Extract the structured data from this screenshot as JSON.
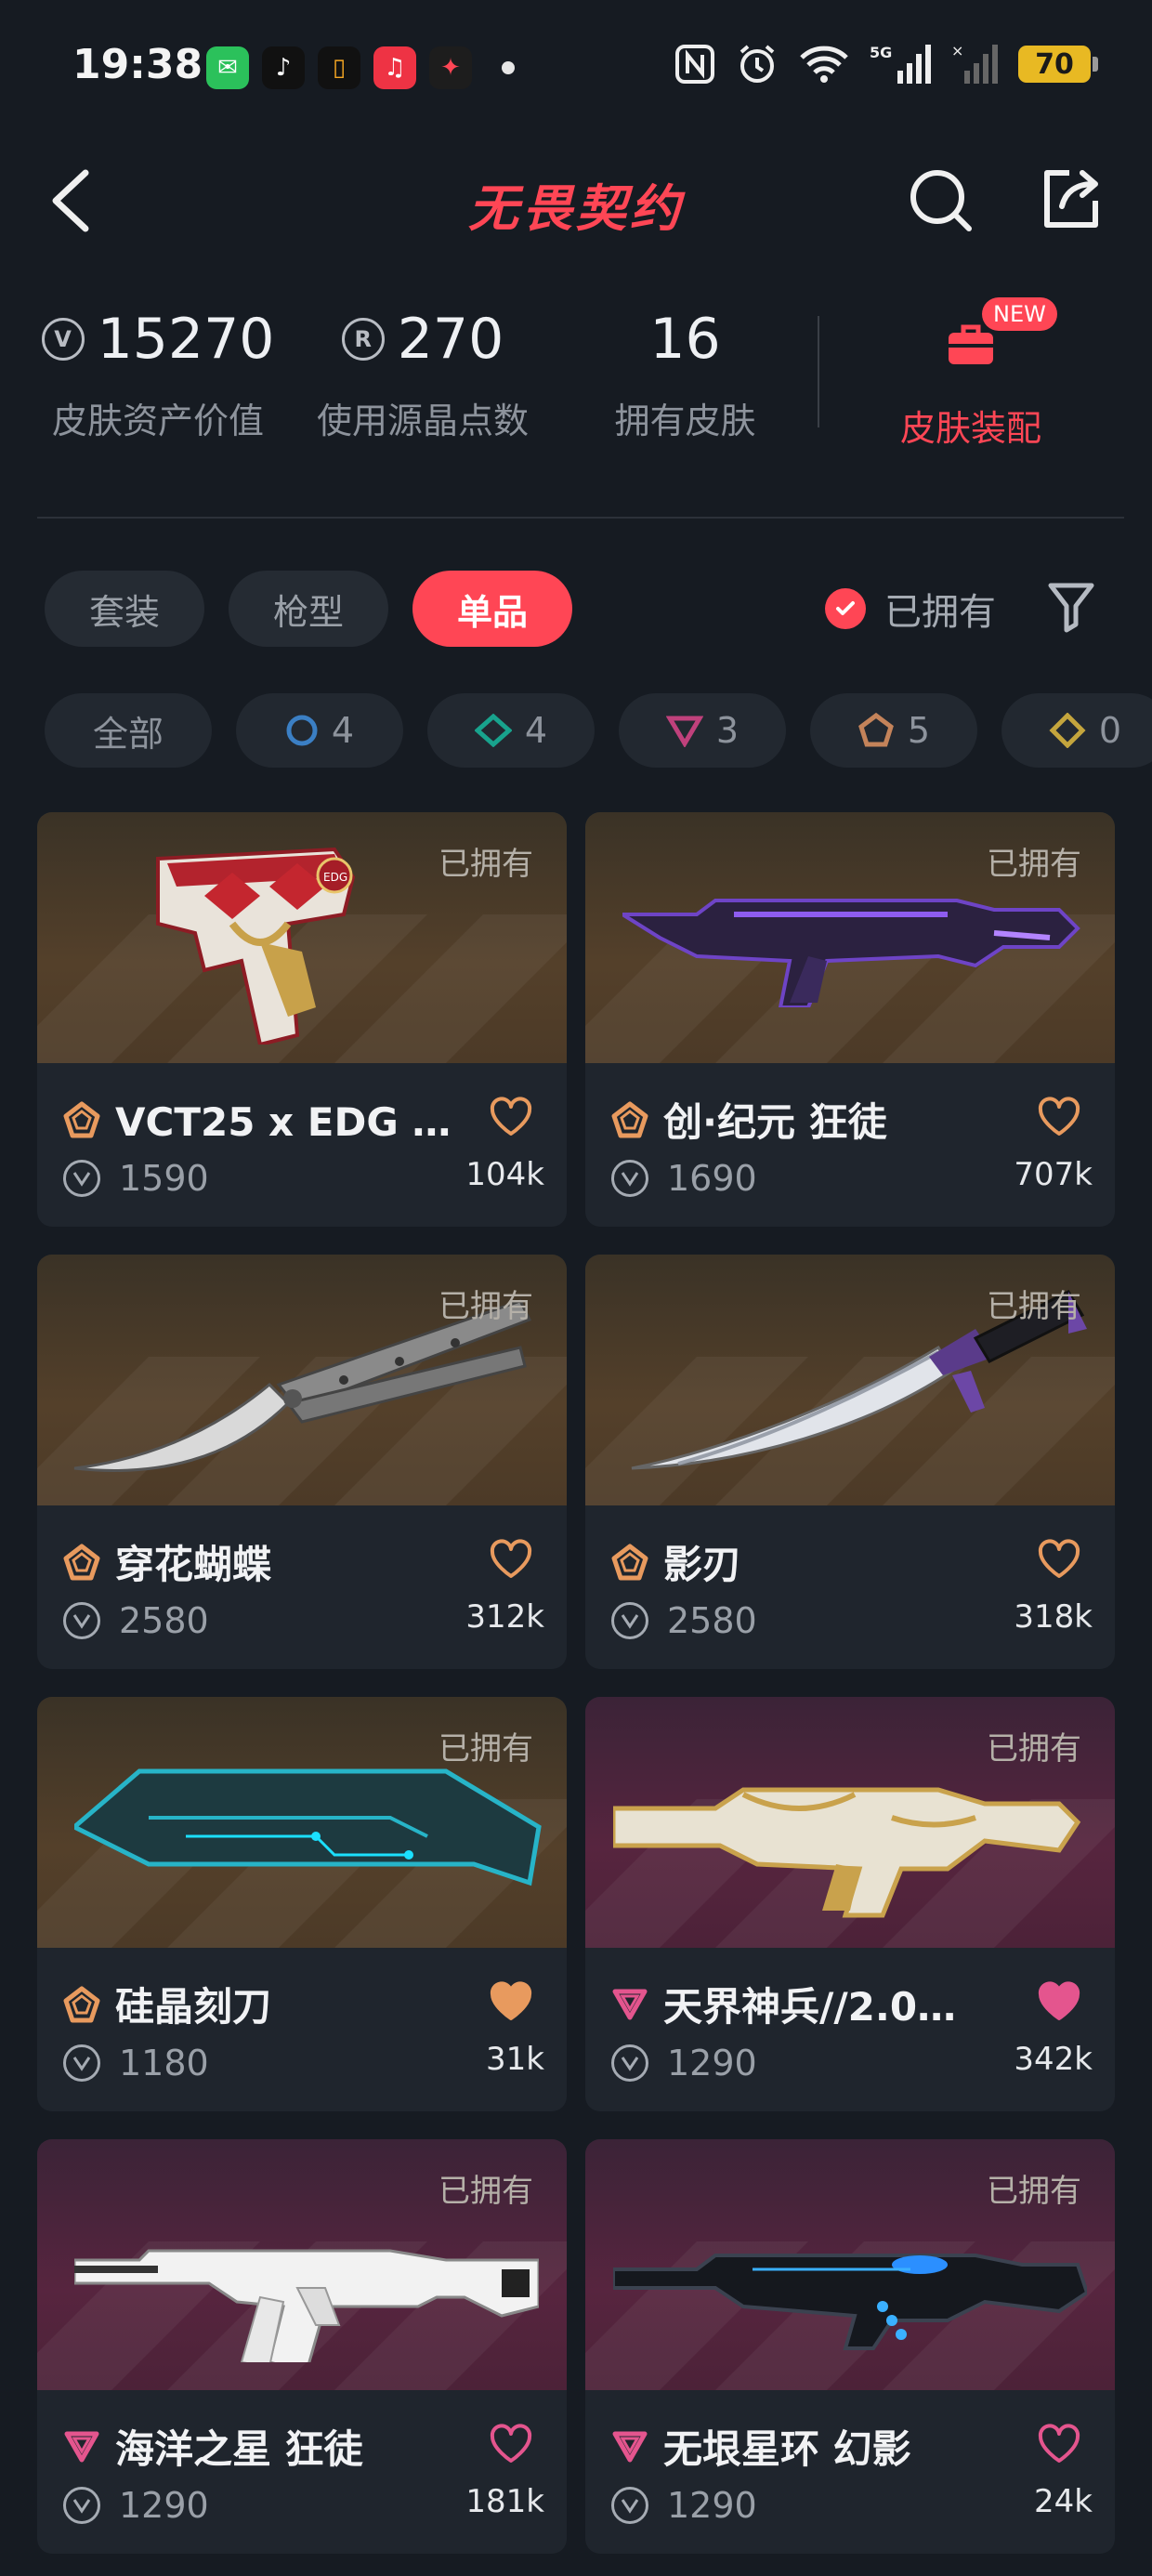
{
  "status_bar": {
    "time": "19:38",
    "apps": [
      "wechat",
      "tiktok",
      "notes",
      "music",
      "game"
    ],
    "network": "5G",
    "battery": "70"
  },
  "header": {
    "title": "无畏契约",
    "back_icon": "chevron-left-icon",
    "search_icon": "search-icon",
    "share_icon": "share-icon"
  },
  "stats": {
    "asset_value": {
      "value": "15270",
      "label": "皮肤资产价值",
      "icon": "vp-icon"
    },
    "radianite": {
      "value": "270",
      "label": "使用源晶点数",
      "icon": "radianite-icon"
    },
    "owned": {
      "value": "16",
      "label": "拥有皮肤"
    },
    "loadout": {
      "label": "皮肤装配",
      "badge": "NEW"
    }
  },
  "tabs": [
    {
      "label": "套装",
      "active": false
    },
    {
      "label": "枪型",
      "active": false
    },
    {
      "label": "单品",
      "active": true
    }
  ],
  "owned_toggle": {
    "label": "已拥有",
    "checked": true
  },
  "tiers": [
    {
      "label": "全部",
      "icon": ""
    },
    {
      "label": "4",
      "icon": "circle",
      "color": "#3b7fc4"
    },
    {
      "label": "4",
      "icon": "diamond",
      "color": "#18a38d"
    },
    {
      "label": "3",
      "icon": "triangle",
      "color": "#c0417c"
    },
    {
      "label": "5",
      "icon": "pentagon",
      "color": "#c4835a"
    },
    {
      "label": "0",
      "icon": "hex-diamond",
      "color": "#c4a53d"
    }
  ],
  "colors": {
    "accent": "#ff4655",
    "tier_exclusive": "#e89a5e",
    "tier_ultra": "#e4558e"
  },
  "items": [
    {
      "name": "VCT25 x EDG 标…",
      "price": "1590",
      "likes": "104k",
      "owned_tag": "已拥有",
      "tier": "exclusive",
      "bg": "gold",
      "weapon": "pistol",
      "liked": false
    },
    {
      "name": "创·纪元 狂徒",
      "price": "1690",
      "likes": "707k",
      "owned_tag": "已拥有",
      "tier": "exclusive",
      "bg": "gold",
      "weapon": "rifle-purple",
      "liked": false
    },
    {
      "name": "穿花蝴蝶",
      "price": "2580",
      "likes": "312k",
      "owned_tag": "已拥有",
      "tier": "exclusive",
      "bg": "gold",
      "weapon": "butterfly-knife",
      "liked": false
    },
    {
      "name": "影刃",
      "price": "2580",
      "likes": "318k",
      "owned_tag": "已拥有",
      "tier": "exclusive",
      "bg": "gold",
      "weapon": "shadow-blade",
      "liked": false
    },
    {
      "name": "硅晶刻刀",
      "price": "1180",
      "likes": "31k",
      "owned_tag": "已拥有",
      "tier": "exclusive",
      "bg": "gold",
      "weapon": "cyber-knife",
      "liked": true
    },
    {
      "name": "天界神兵//2.0…",
      "price": "1290",
      "likes": "342k",
      "owned_tag": "已拥有",
      "tier": "ultra",
      "bg": "purple",
      "weapon": "rifle-gold",
      "liked": true
    },
    {
      "name": "海洋之星 狂徒",
      "price": "1290",
      "likes": "181k",
      "owned_tag": "已拥有",
      "tier": "ultra",
      "bg": "purple",
      "weapon": "rifle-white",
      "liked": false
    },
    {
      "name": "无垠星环 幻影",
      "price": "1290",
      "likes": "24k",
      "owned_tag": "已拥有",
      "tier": "ultra",
      "bg": "purple",
      "weapon": "rifle-black",
      "liked": false
    }
  ]
}
